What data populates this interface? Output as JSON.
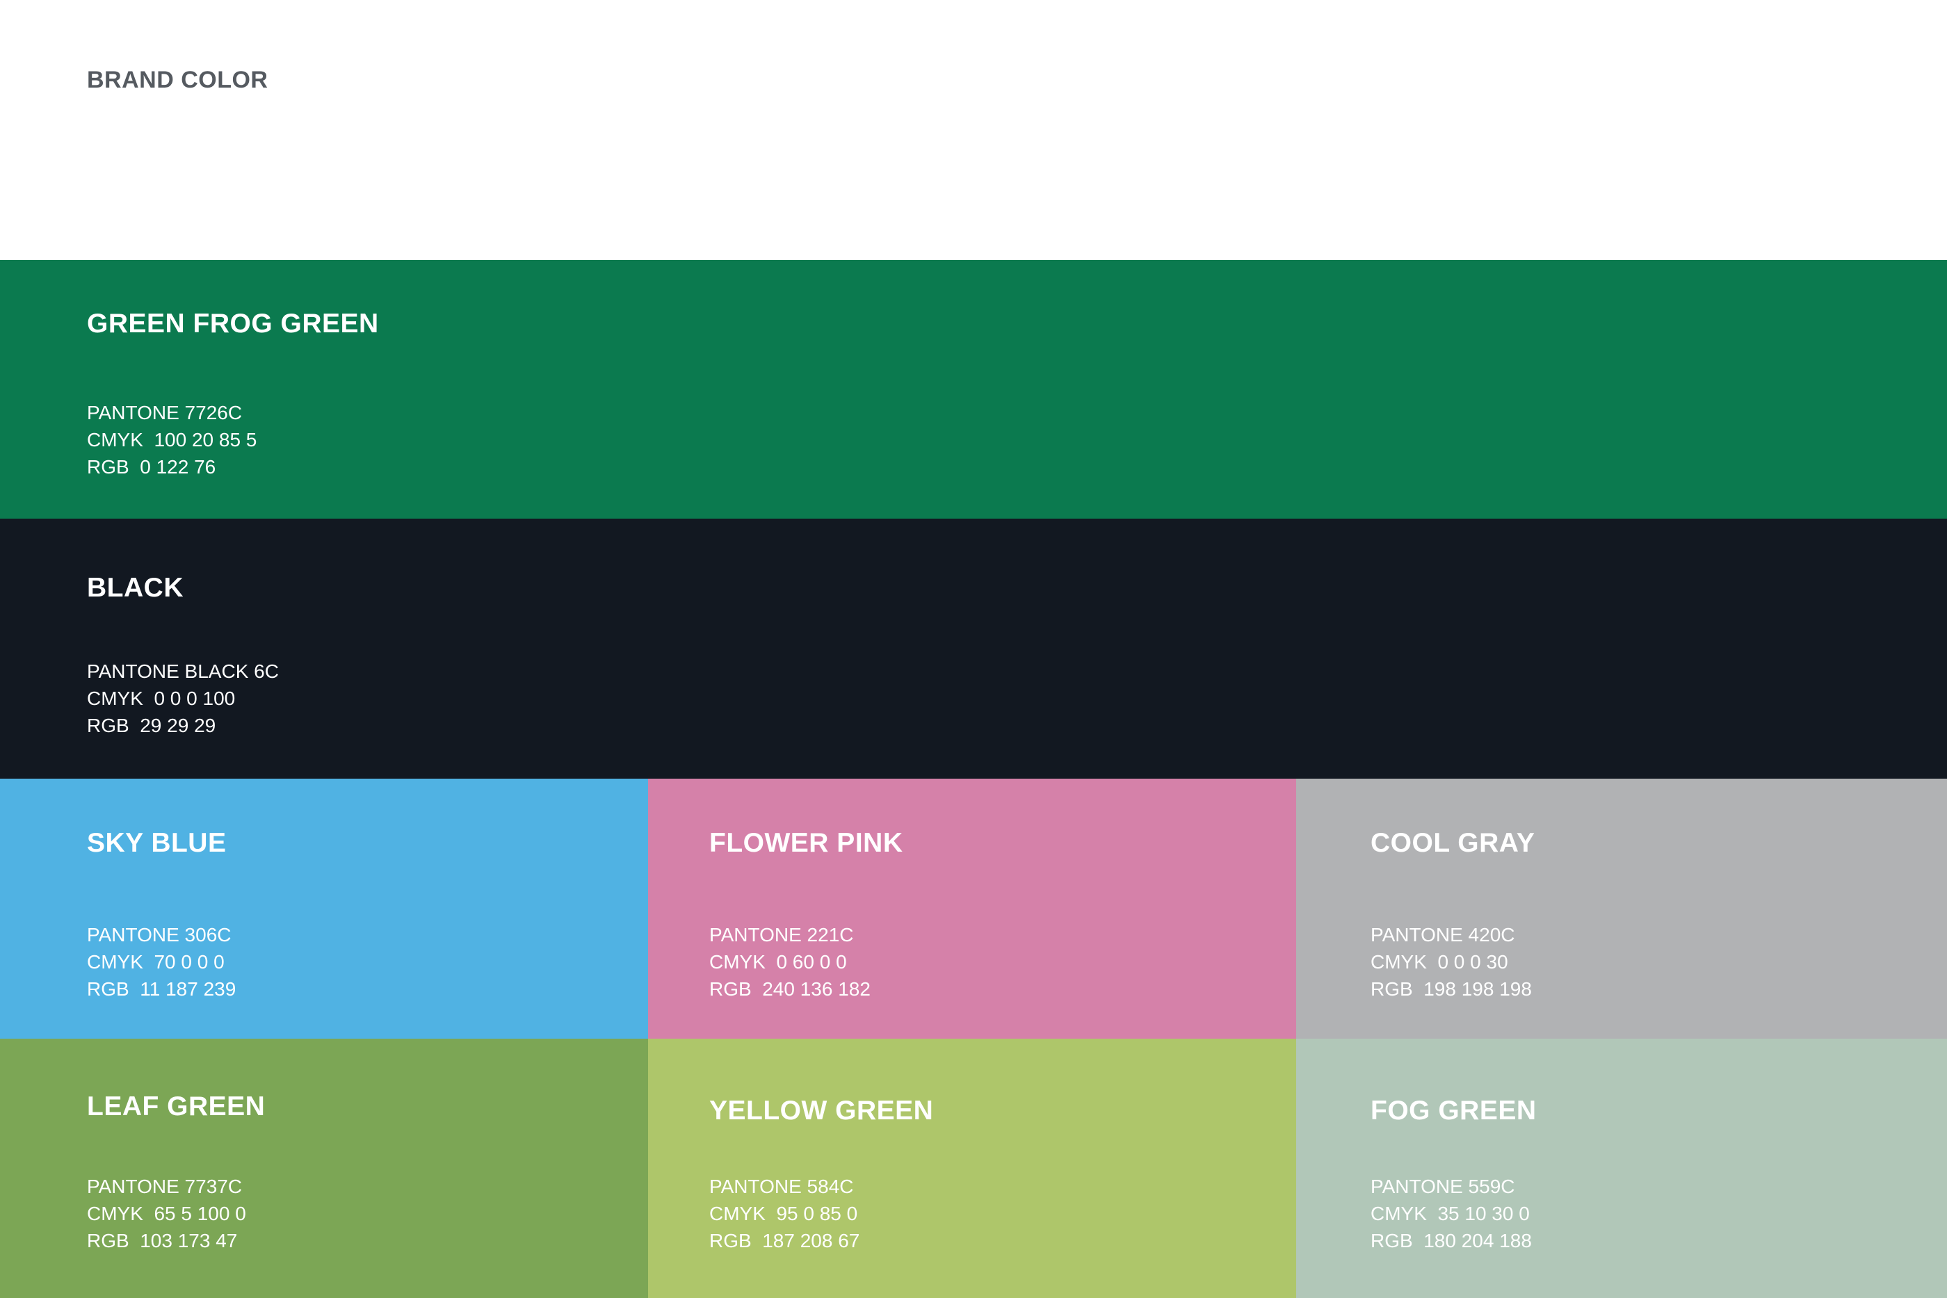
{
  "title": "BRAND COLOR",
  "swatches": [
    {
      "name": "GREEN FROG GREEN",
      "pantone": "PANTONE 7726C",
      "cmyk": "CMYK  100 20 85 5",
      "rgb": "RGB  0 122 76",
      "color": "#0b7a4f"
    },
    {
      "name": "BLACK",
      "pantone": "PANTONE BLACK 6C",
      "cmyk": "CMYK  0 0 0 100",
      "rgb": "RGB  29 29 29",
      "color": "#121821"
    },
    {
      "name": "SKY BLUE",
      "pantone": "PANTONE 306C",
      "cmyk": "CMYK  70 0 0 0",
      "rgb": "RGB  11 187 239",
      "color": "#50b2e3"
    },
    {
      "name": "FLOWER PINK",
      "pantone": "PANTONE 221C",
      "cmyk": "CMYK  0 60 0 0",
      "rgb": "RGB  240 136 182",
      "color": "#d581a9"
    },
    {
      "name": "COOL GRAY",
      "pantone": "PANTONE 420C",
      "cmyk": "CMYK  0 0 0 30",
      "rgb": "RGB  198 198 198",
      "color": "#b1b2b4"
    },
    {
      "name": "LEAF GREEN",
      "pantone": "PANTONE 7737C",
      "cmyk": "CMYK  65 5 100 0",
      "rgb": "RGB  103 173 47",
      "color": "#7ca655"
    },
    {
      "name": "YELLOW GREEN",
      "pantone": "PANTONE 584C",
      "cmyk": "CMYK  95 0 85 0",
      "rgb": "RGB  187 208 67",
      "color": "#aec66a"
    },
    {
      "name": "FOG GREEN",
      "pantone": "PANTONE 559C",
      "cmyk": "CMYK  35 10 30 0",
      "rgb": "RGB  180 204 188",
      "color": "#b1c7b8"
    }
  ]
}
